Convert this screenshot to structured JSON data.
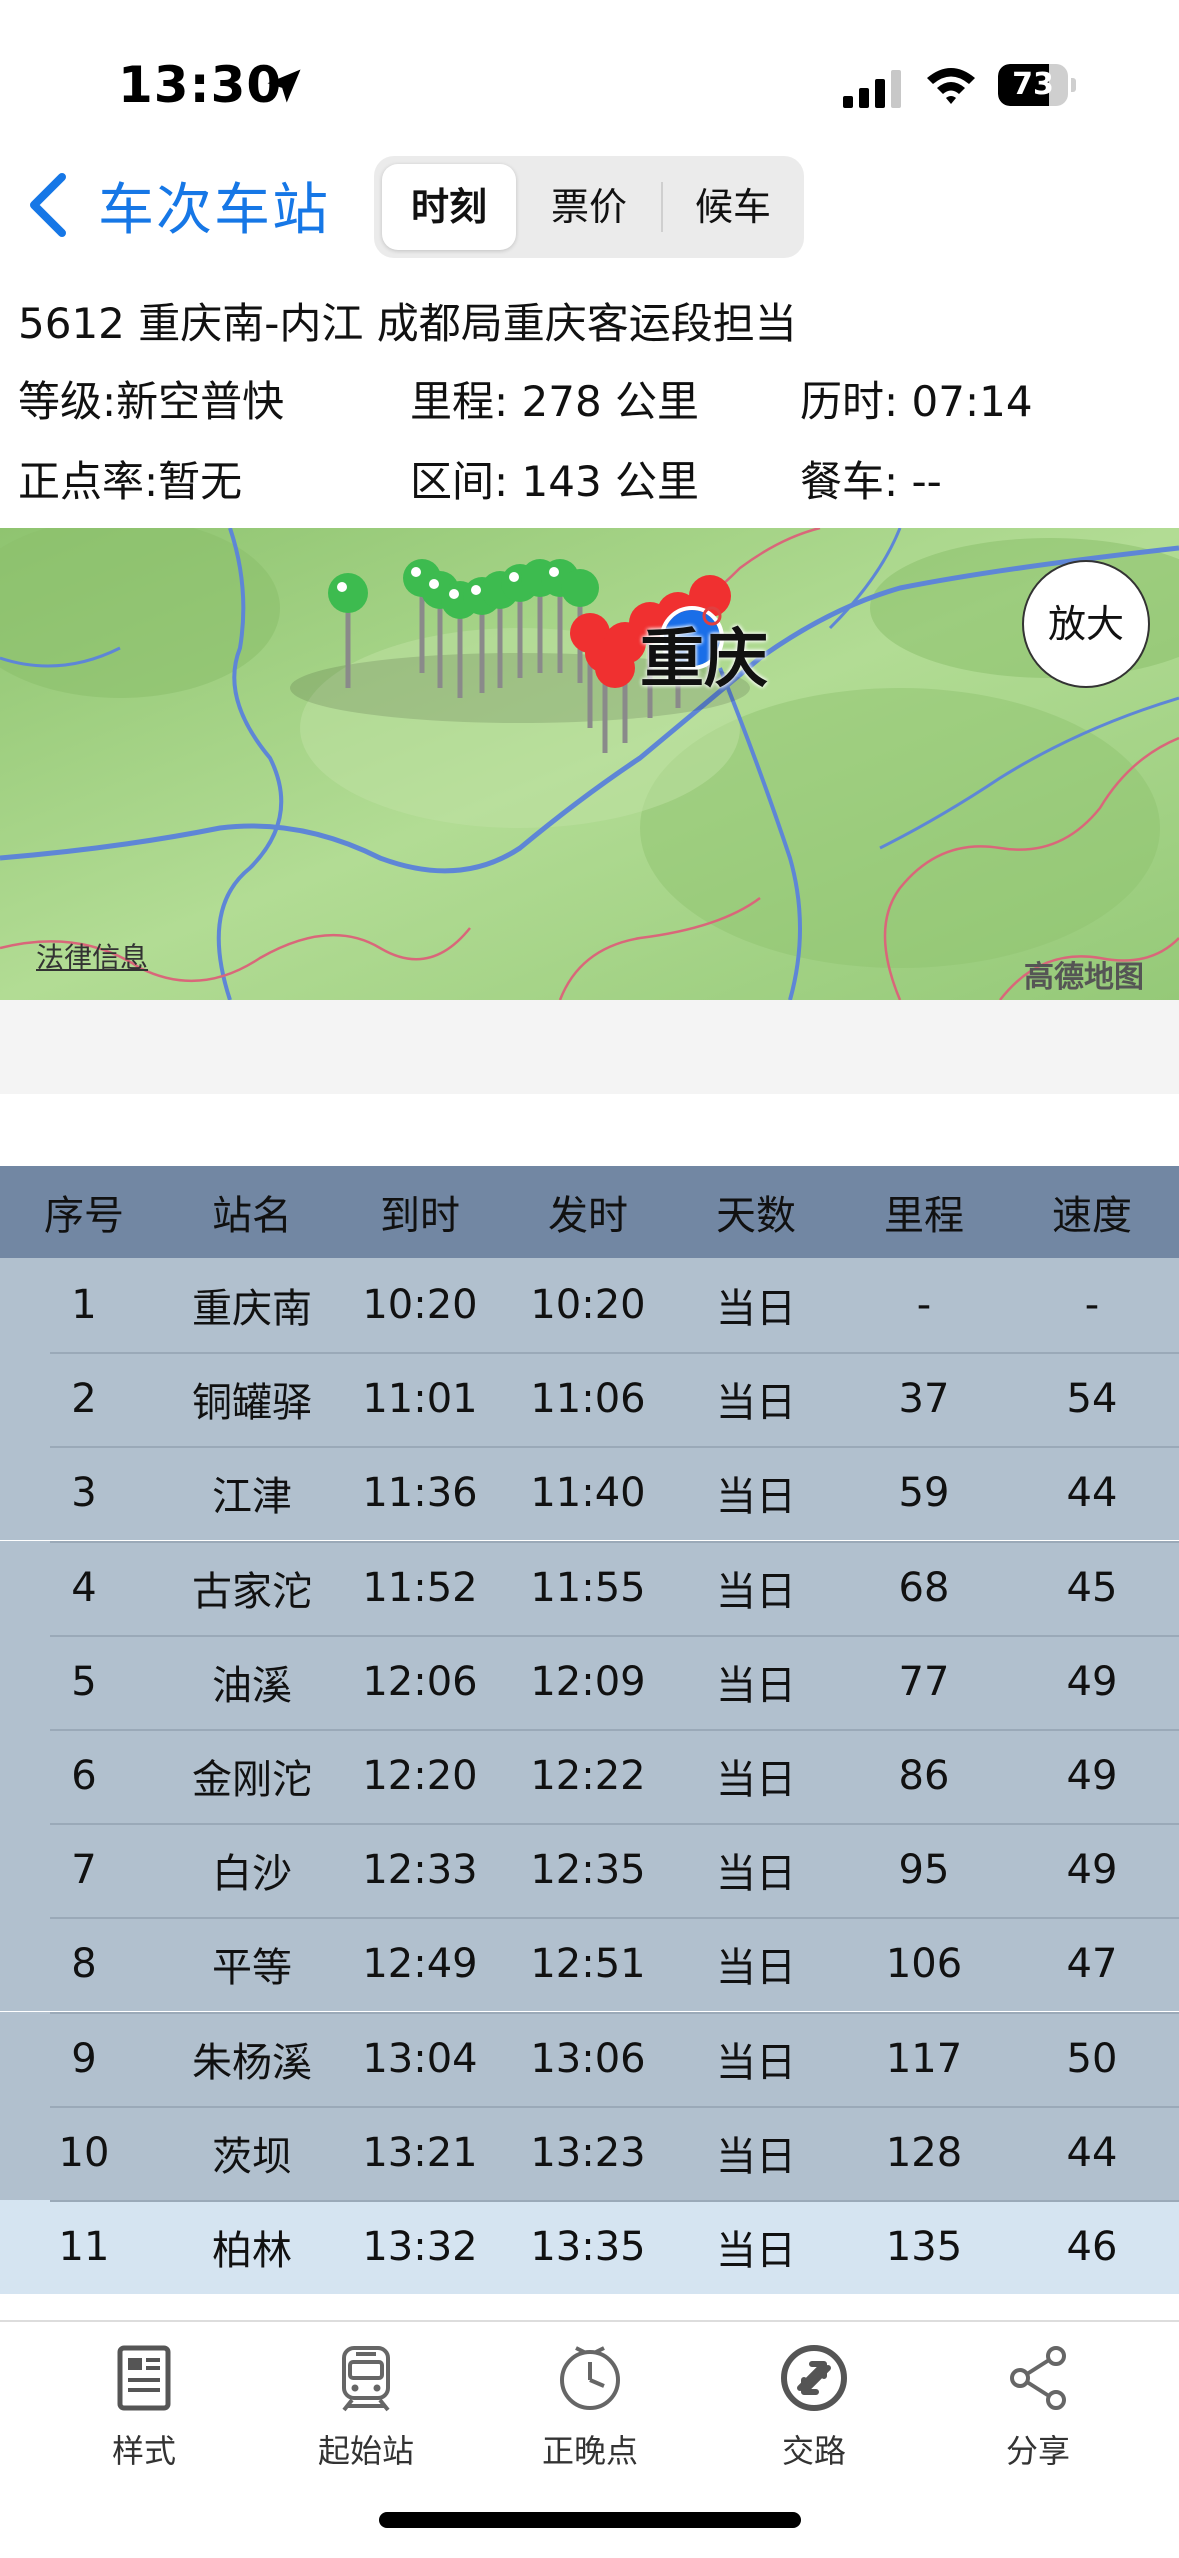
{
  "status": {
    "time": "13:30",
    "battery": "73",
    "battery_level": 0.73
  },
  "nav": {
    "back_label": "车次车站",
    "tabs": [
      {
        "label": "时刻",
        "active": true
      },
      {
        "label": "票价",
        "active": false
      },
      {
        "label": "候车",
        "active": false
      }
    ]
  },
  "train": {
    "title": "5612   重庆南-内江 成都局重庆客运段担当",
    "grade": "等级:新空普快",
    "mileage": "里程: 278 公里",
    "duration": "历时: 07:14",
    "punctuality": "正点率:暂无",
    "section": "区间: 143 公里",
    "dining": "餐车: --"
  },
  "map": {
    "zoom_label": "放大",
    "city_label": "重庆",
    "legal_label": "法律信息",
    "brand": "高德地图",
    "colors": {
      "land": "#a9d78a",
      "river": "#5e86d6",
      "border": "#d9677a",
      "past_pin": "#3dbb4f",
      "future_pin": "#f03030",
      "current": "#1a6ee8"
    }
  },
  "timetable": {
    "headers": [
      "序号",
      "站名",
      "到时",
      "发时",
      "天数",
      "里程",
      "速度"
    ],
    "rows": [
      [
        "1",
        "重庆南",
        "10:20",
        "10:20",
        "当日",
        "-",
        "-"
      ],
      [
        "2",
        "铜罐驿",
        "11:01",
        "11:06",
        "当日",
        "37",
        "54"
      ],
      [
        "3",
        "江津",
        "11:36",
        "11:40",
        "当日",
        "59",
        "44"
      ],
      [
        "4",
        "古家沱",
        "11:52",
        "11:55",
        "当日",
        "68",
        "45"
      ],
      [
        "5",
        "油溪",
        "12:06",
        "12:09",
        "当日",
        "77",
        "49"
      ],
      [
        "6",
        "金刚沱",
        "12:20",
        "12:22",
        "当日",
        "86",
        "49"
      ],
      [
        "7",
        "白沙",
        "12:33",
        "12:35",
        "当日",
        "95",
        "49"
      ],
      [
        "8",
        "平等",
        "12:49",
        "12:51",
        "当日",
        "106",
        "47"
      ],
      [
        "9",
        "朱杨溪",
        "13:04",
        "13:06",
        "当日",
        "117",
        "50"
      ],
      [
        "10",
        "茨坝",
        "13:21",
        "13:23",
        "当日",
        "128",
        "44"
      ],
      [
        "11",
        "柏林",
        "13:32",
        "13:35",
        "当日",
        "135",
        "46"
      ]
    ],
    "highlight_row": 11,
    "colors": {
      "header": "#7287a3",
      "row": "#b1c0ce",
      "highlight": "#d5e4f1"
    }
  },
  "tabbar": {
    "items": [
      {
        "label": "样式",
        "icon": "document-icon"
      },
      {
        "label": "起始站",
        "icon": "train-icon"
      },
      {
        "label": "正晚点",
        "icon": "clock-icon"
      },
      {
        "label": "交路",
        "icon": "swap-icon"
      },
      {
        "label": "分享",
        "icon": "share-icon"
      }
    ]
  }
}
